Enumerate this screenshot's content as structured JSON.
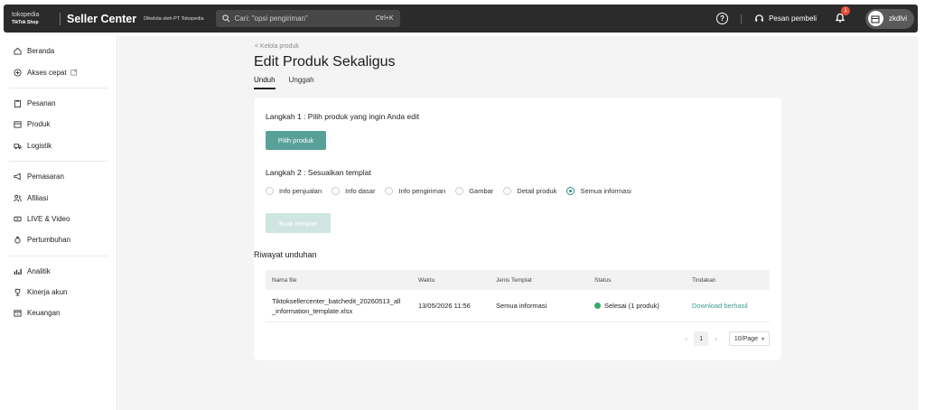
{
  "topbar": {
    "brand_top": "tokopedia",
    "brand_bottom": "TikTok Shop",
    "app_title": "Seller Center",
    "managed_by": "Dikelola oleh PT Tokopedia",
    "search_placeholder": "Cari: \"opsi pengiriman\"",
    "search_shortcut": "Ctrl+K",
    "chat_label": "Pesan pembeli",
    "notification_count": "1",
    "username": "zkdlvi"
  },
  "sidebar": {
    "groups": [
      [
        {
          "label": "Beranda",
          "icon": "home-icon"
        },
        {
          "label": "Akses cepat",
          "icon": "plus-circle-icon"
        }
      ],
      [
        {
          "label": "Pesanan",
          "icon": "clipboard-icon"
        },
        {
          "label": "Produk",
          "icon": "box-icon"
        },
        {
          "label": "Logistik",
          "icon": "truck-icon"
        }
      ],
      [
        {
          "label": "Pemasaran",
          "icon": "megaphone-icon"
        },
        {
          "label": "Afiliasi",
          "icon": "people-icon"
        },
        {
          "label": "LIVE & Video",
          "icon": "video-icon"
        },
        {
          "label": "Pertumbuhan",
          "icon": "growth-icon"
        }
      ],
      [
        {
          "label": "Analitik",
          "icon": "chart-icon"
        },
        {
          "label": "Kinerja akun",
          "icon": "trophy-icon"
        },
        {
          "label": "Keuangan",
          "icon": "wallet-icon"
        }
      ]
    ]
  },
  "main": {
    "breadcrumb": "< Kelola produk",
    "title": "Edit Produk Sekaligus",
    "tabs": [
      "Unduh",
      "Unggah"
    ],
    "step1_title": "Langkah 1 :  Pilih produk yang ingin Anda edit",
    "step1_button": "Pilih produk",
    "step2_title": "Langkah 2 :  Sesuaikan templat",
    "template_options": [
      "Info penjualan",
      "Info dasar",
      "Info pengiriman",
      "Gambar",
      "Detail produk",
      "Semua informasi"
    ],
    "selected_option": "Semua informasi",
    "create_button": "Buat templat",
    "history_title": "Riwayat unduhan",
    "table": {
      "headers": [
        "Nama file",
        "Waktu",
        "Jenis Templat",
        "Status",
        "Tindakan"
      ],
      "rows": [
        {
          "file_line1": "Tiktoksellercenter_batchedit_20260513_all",
          "file_line2": "_information_template.xlsx",
          "time": "13/05/2026 11:56",
          "template_type": "Semua informasi",
          "status": "Selesai (1 produk)",
          "action": "Download berhasil"
        }
      ]
    },
    "pagination": {
      "current_page": "1",
      "page_size": "10/Page"
    }
  },
  "colors": {
    "primary": "#58a199",
    "primary_disabled": "#cfe5e2",
    "topbar_bg": "#2b2b2b",
    "success": "#3aa86b",
    "link": "#3f9a8f"
  }
}
